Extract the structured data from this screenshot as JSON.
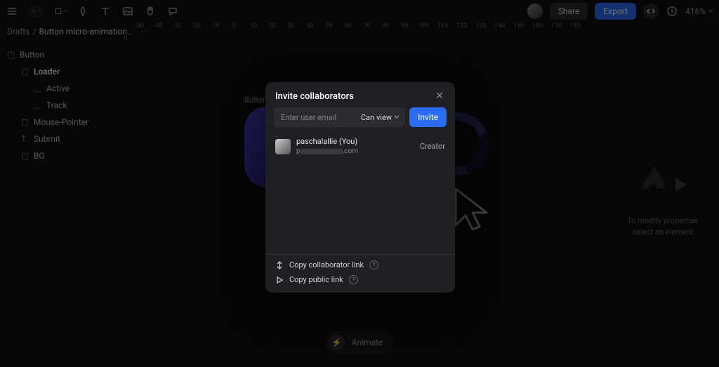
{
  "topbar": {
    "share": "Share",
    "export": "Export",
    "zoom": "416%"
  },
  "breadcrumb": {
    "folder": "Drafts",
    "file": "Button micro-animation..."
  },
  "layers": {
    "button": "Button",
    "loader": "Loader",
    "active": "Active",
    "track": "Track",
    "mouse_pointer": "Mouse-Pointer",
    "submit": "Submit",
    "bg": "BG"
  },
  "ruler_h": [
    "-50",
    "-40",
    "-30",
    "-20",
    "-10",
    "0",
    "10",
    "20",
    "30",
    "40",
    "50",
    "60",
    "70",
    "80",
    "90",
    "100",
    "110",
    "120",
    "130",
    "140",
    "150",
    "160",
    "170",
    "180"
  ],
  "ruler_v": [
    "0",
    "",
    "",
    "",
    "",
    "",
    "",
    "",
    "",
    ""
  ],
  "canvas": {
    "frame_label": "Button"
  },
  "right_panel": {
    "hint_l1": "To modify properties",
    "hint_l2": "select an element"
  },
  "animate": {
    "label": "Animate"
  },
  "modal": {
    "title": "Invite collaborators",
    "email_placeholder": "Enter user email",
    "permission": "Can view",
    "invite_btn": "Invite",
    "user_name": "paschalallie (You)",
    "user_email_prefix": "p",
    "user_email_suffix": ".com",
    "role": "Creator",
    "copy_collab": "Copy collaborator link",
    "copy_public": "Copy public link"
  }
}
